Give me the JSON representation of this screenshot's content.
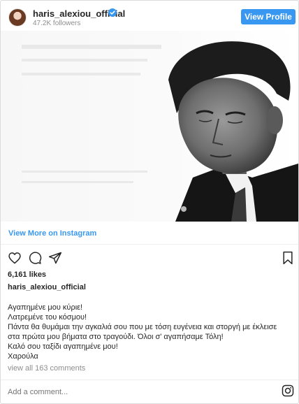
{
  "header": {
    "username": "haris_alexiou_official",
    "followers": "47.2K followers",
    "view_profile_label": "View Profile"
  },
  "post": {
    "image_icon": "black-and-white-portrait-photo",
    "view_more_label": "View More on Instagram",
    "likes": "6,161 likes",
    "caption_user": "haris_alexiou_official",
    "caption_lines": [
      "Αγαπημένε μου κύριε!",
      "Λατρεμένε του κόσμου!",
      "Πάντα θα θυμάμαι την αγκαλιά σου που με τόση ευγένεια και στοργή με έκλεισε",
      "στα πρώτα μου βήματα στο τραγούδι. Όλοι σ' αγαπήσαμε Τόλη!",
      "Καλό σου ταξίδι αγαπημένε μου!",
      "Χαρούλα"
    ],
    "view_comments": "view all 163 comments",
    "add_comment_placeholder": "Add a comment..."
  },
  "icons": {
    "verified": "verified-badge-icon",
    "like": "heart-icon",
    "comment": "comment-icon",
    "share": "share-icon",
    "save": "bookmark-icon",
    "instagram": "instagram-icon"
  },
  "colors": {
    "accent": "#3897f0",
    "muted": "#8e8e8e",
    "text": "#262626",
    "border": "#dbdbdb"
  }
}
